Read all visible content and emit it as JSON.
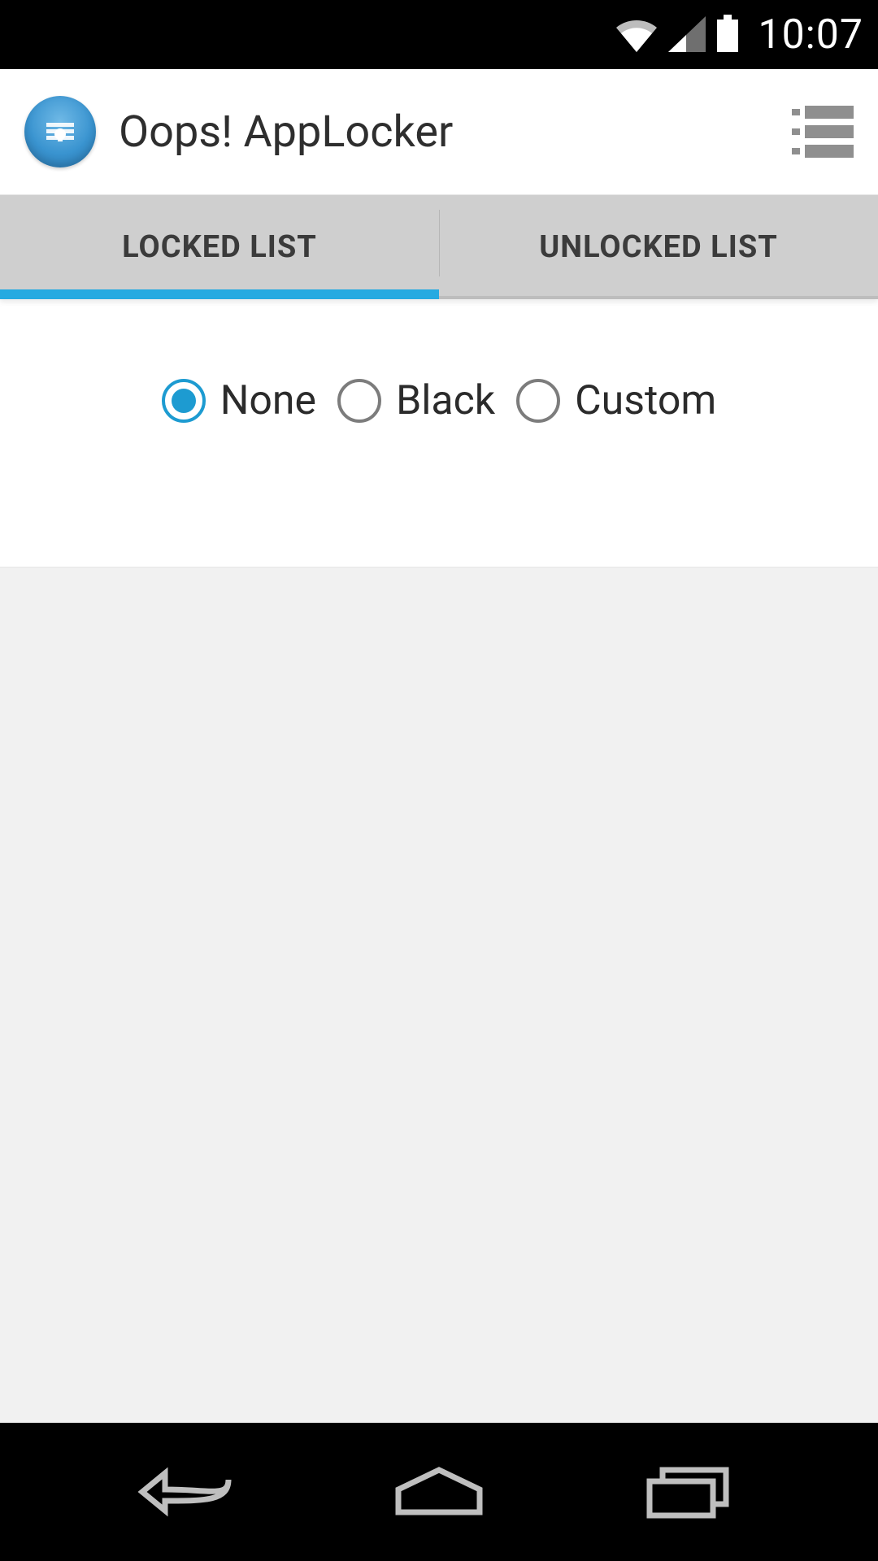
{
  "statusbar": {
    "time": "10:07"
  },
  "appbar": {
    "title": "Oops! AppLocker"
  },
  "tabs": {
    "items": [
      {
        "label": "LOCKED LIST",
        "active": true
      },
      {
        "label": "UNLOCKED LIST",
        "active": false
      }
    ]
  },
  "radio": {
    "options": [
      {
        "label": "None",
        "selected": true
      },
      {
        "label": "Black",
        "selected": false
      },
      {
        "label": "Custom",
        "selected": false
      }
    ]
  }
}
